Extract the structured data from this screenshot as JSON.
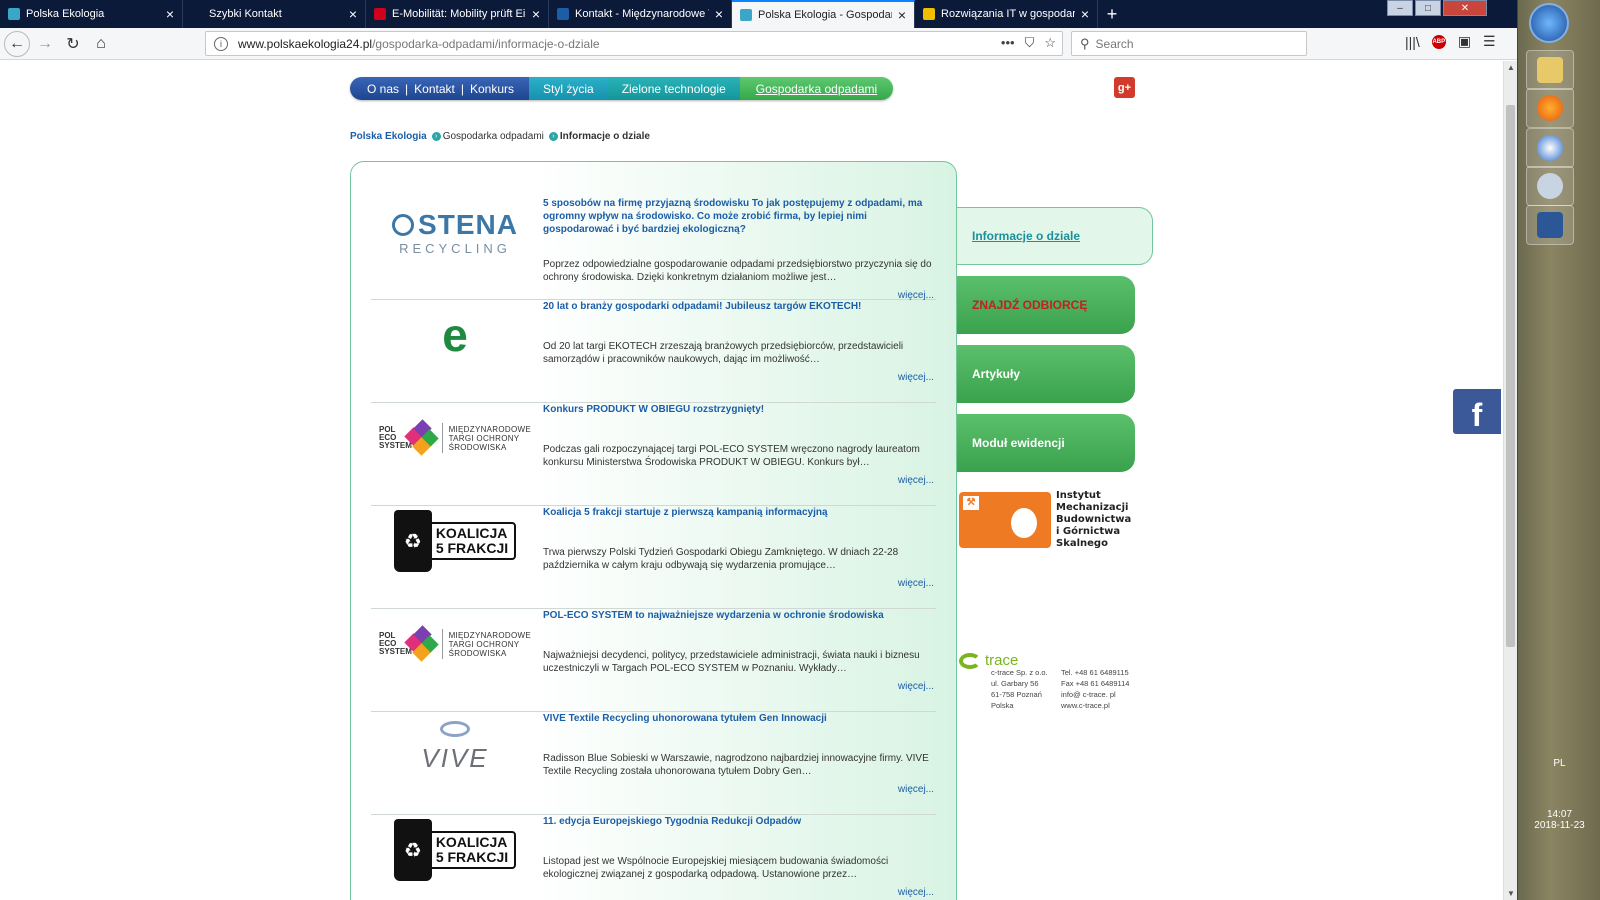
{
  "browser": {
    "tabs": [
      {
        "title": "Polska Ekologia",
        "favicon_color": "#3aa6c8",
        "active": false
      },
      {
        "title": "Szybki Kontakt",
        "favicon_color": "#0c1a3a",
        "active": false
      },
      {
        "title": "E-Mobilität: Mobility prüft Eins",
        "favicon_color": "#d0021b",
        "active": false
      },
      {
        "title": "Kontakt - Międzynarodowe Tar",
        "favicon_color": "#1b5ea7",
        "active": false
      },
      {
        "title": "Polska Ekologia - Gospodarka o",
        "favicon_color": "#3aa6c8",
        "active": true
      },
      {
        "title": "Rozwiązania IT w gospodarce o",
        "favicon_color": "#f0c000",
        "active": false
      }
    ],
    "new_tab_label": "+",
    "url_host": "www.polskaekologia24.pl",
    "url_path": "/gospodarka-odpadami/informacje-o-dziale",
    "url_actions": [
      "•••",
      "⛉",
      "☆"
    ],
    "search_placeholder": "Search"
  },
  "site": {
    "nav": {
      "group": [
        "O nas",
        "Kontakt",
        "Konkurs"
      ],
      "sep": "|",
      "item2": "Styl życia",
      "item3": "Zielone technologie",
      "item4": "Gospodarka odpadami"
    },
    "gplus": "g+",
    "breadcrumb": [
      "Polska Ekologia",
      "Gospodarka odpadami",
      "Informacje o dziale"
    ],
    "more_label": "więcej...",
    "articles": [
      {
        "title": "5 sposobów na firmę przyjazną środowisku To jak postępujemy z odpadami, ma ogromny wpływ na środowisko. Co może zrobić firma, by lepiej nimi gospodarować i być bardziej ekologiczną?",
        "desc": "Poprzez odpowiedzialne gospodarowanie odpadami przedsiębiorstwo przyczynia się do ochrony środowiska. Dzięki konkretnym działaniom możliwe jest…",
        "logo": "stena"
      },
      {
        "title": "20 lat o branży gospodarki odpadami! Jubileusz targów EKOTECH!",
        "desc": "Od 20 lat targi EKOTECH zrzeszają branżowych przedsiębiorców, przedstawicieli samorządów i pracowników naukowych, dając im możliwość…",
        "logo": "ekotech"
      },
      {
        "title": "Konkurs PRODUKT W OBIEGU rozstrzygnięty!",
        "desc": "Podczas gali rozpoczynającej targi POL-ECO SYSTEM wręczono nagrody laureatom konkursu Ministerstwa Środowiska PRODUKT W OBIEGU. Konkurs był…",
        "logo": "poleco"
      },
      {
        "title": "Koalicja 5 frakcji startuje z pierwszą kampanią informacyjną",
        "desc": "Trwa pierwszy Polski Tydzień Gospodarki Obiegu Zamkniętego. W dniach 22-28 października w całym kraju odbywają się wydarzenia promujące…",
        "logo": "koalicja"
      },
      {
        "title": "POL-ECO SYSTEM to najważniejsze wydarzenia w ochronie środowiska",
        "desc": "Najważniejsi decydenci, politycy, przedstawiciele administracji, świata nauki i biznesu uczestniczyli w Targach POL-ECO SYSTEM w Poznaniu. Wykłady…",
        "logo": "poleco"
      },
      {
        "title": "VIVE Textile Recycling uhonorowana tytułem Gen Innowacji",
        "desc": "Radisson Blue Sobieski w Warszawie, nagrodzono najbardziej innowacyjne firmy. VIVE Textile Recycling została uhonorowana tytułem Dobry Gen…",
        "logo": "vive"
      },
      {
        "title": "11. edycja Europejskiego Tygodnia Redukcji Odpadów",
        "desc": "Listopad jest we Wspólnocie Europejskiej miesiącem budowania świadomości ekologicznej związanej z gospodarką odpadową. Ustanowione przez…",
        "logo": "koalicja"
      }
    ],
    "logos": {
      "stena_top": "STENA",
      "stena_bottom": "RECYCLING",
      "ekotech_glyph": "e",
      "poleco_left": "POL\nECO\nSYSTEM",
      "poleco_right": "MIĘDZYNARODOWE\nTARGI OCHRONY\nŚRODOWISKA",
      "koalicja": "KOALICJA\n5 FRAKCJI",
      "vive": "VIVE"
    },
    "side_menu": [
      {
        "label": "Informacje o dziale",
        "active": true
      },
      {
        "label": "ZNAJDŹ ODBIORCĘ",
        "highlight": "#c0221f"
      },
      {
        "label": "Artykuły"
      },
      {
        "label": "Moduł ewidencji"
      }
    ],
    "imbgs_name": "Instytut\nMechanizacji\nBudownictwa\ni Górnictwa\nSkalnego",
    "ctrace": {
      "brand": "trace",
      "address": "c-trace Sp. z o.o.\nul. Garbary 56\n61-758 Poznań\nPolska",
      "contact": "Tel. +48 61 6489115\nFax +48 61 6489114\ninfo@ c-trace. pl\nwww.c-trace.pl"
    },
    "facebook": "f"
  },
  "taskbar": {
    "lang": "PL",
    "time": "14:07",
    "date": "2018-11-23"
  },
  "colors": {
    "brand_blue": "#1b5ea7",
    "brand_green": "#3aa14c",
    "tab_bar": "#0c1a3a"
  }
}
